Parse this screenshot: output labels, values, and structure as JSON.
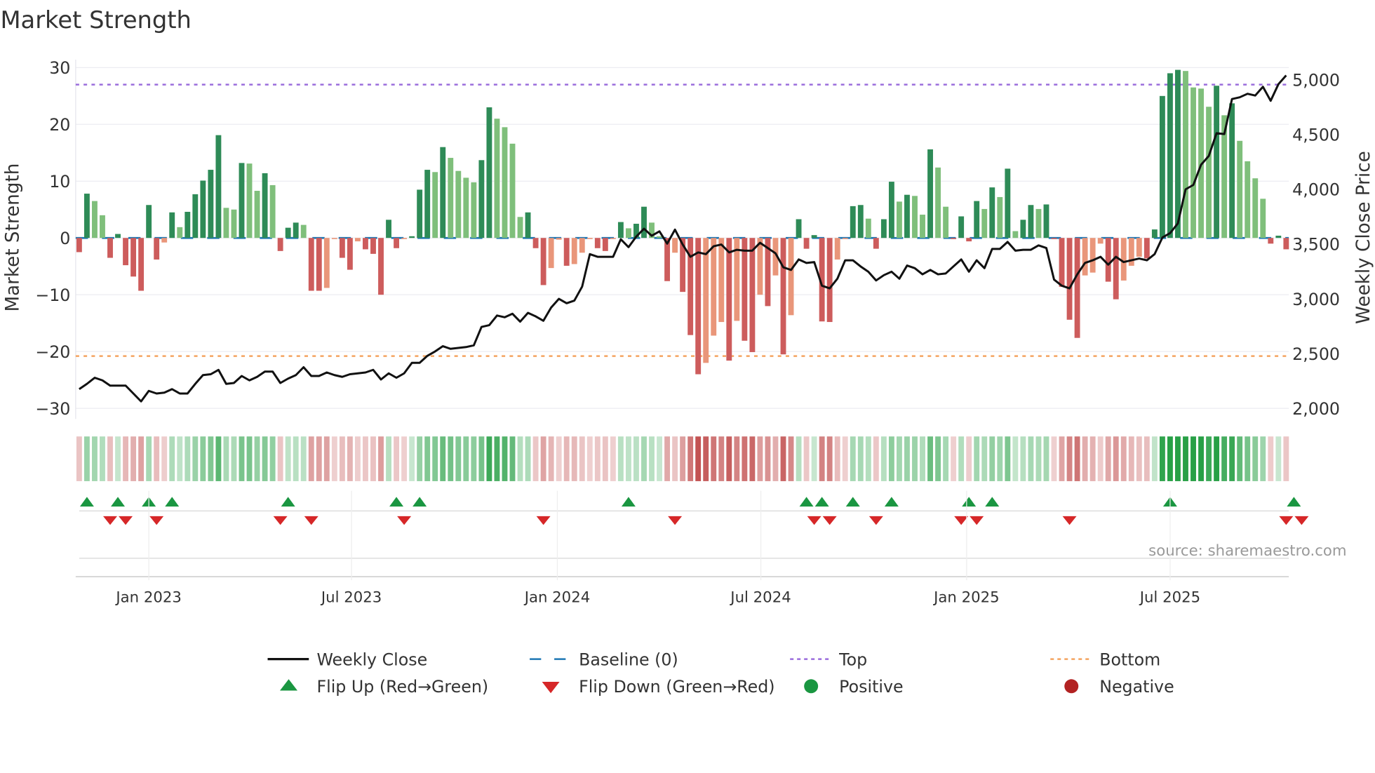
{
  "chart_data": {
    "type": "bar",
    "title": "Market Strength",
    "ylabel": "Market Strength",
    "y2label": "Weekly Close Price",
    "ylim": [
      -31.5,
      31.5
    ],
    "y2lim": [
      1900,
      5100
    ],
    "yticks": [
      30,
      20,
      10,
      0,
      -10,
      -20,
      -30
    ],
    "ytick_labels": [
      "30",
      "20",
      "10",
      "0",
      "−10",
      "−20",
      "−30"
    ],
    "y2ticks": [
      5000,
      4500,
      4000,
      3500,
      3000,
      2500,
      2000
    ],
    "y2tick_labels": [
      "5,000",
      "4,500",
      "4,000",
      "3,500",
      "3,000",
      "2,500",
      "2,000"
    ],
    "xticks": [
      {
        "index": 9,
        "label": "Jan 2023"
      },
      {
        "index": 35.2,
        "label": "Jul 2023"
      },
      {
        "index": 61.8,
        "label": "Jan 2024"
      },
      {
        "index": 88.1,
        "label": "Jul 2024"
      },
      {
        "index": 114.7,
        "label": "Jan 2025"
      },
      {
        "index": 141,
        "label": "Jul 2025"
      }
    ],
    "top_level": 27,
    "bottom_level": -20.8,
    "strength": [
      -2.5,
      7.8,
      6.5,
      4,
      -3.5,
      0.7,
      -4.8,
      -6.8,
      -9.3,
      5.8,
      -3.8,
      -0.8,
      4.5,
      1.9,
      4.6,
      7.7,
      10.1,
      12,
      18.1,
      5.3,
      5,
      13.2,
      13.1,
      8.3,
      11.4,
      9.3,
      -2.3,
      1.8,
      2.7,
      2.3,
      -9.3,
      -9.3,
      -8.8,
      -0.2,
      -3.5,
      -5.6,
      -0.6,
      -2,
      -2.8,
      -10,
      3.2,
      -1.8,
      -0.2,
      0.3,
      8.5,
      12,
      11.6,
      16,
      14.1,
      11.8,
      10.6,
      9.8,
      13.7,
      23,
      21,
      19.5,
      16.6,
      3.7,
      4.5,
      -1.8,
      -8.3,
      -5.3,
      -0.3,
      -4.9,
      -4.6,
      -2.6,
      -0.2,
      -1.8,
      -2.3,
      -0.2,
      2.8,
      1.7,
      2.5,
      5.5,
      2.7,
      0.3,
      -7.6,
      -2.6,
      -9.5,
      -17.1,
      -24,
      -22,
      -17.2,
      -14.8,
      -21.6,
      -14.6,
      -18.1,
      -20.1,
      -10,
      -12,
      -6.6,
      -20.5,
      -13.6,
      3.3,
      -1.9,
      0.5,
      -14.7,
      -14.8,
      -3.8,
      -0.2,
      5.6,
      5.8,
      3.4,
      -1.9,
      3.3,
      9.9,
      6.4,
      7.6,
      7.4,
      4.1,
      15.6,
      12.4,
      5.5,
      -0.2,
      3.8,
      -0.6,
      6.5,
      5.1,
      8.9,
      7.2,
      12.2,
      1.2,
      3.2,
      5.8,
      5.1,
      5.9,
      -0.2,
      -8.6,
      -14.4,
      -17.6,
      -6.6,
      -6.1,
      -1,
      -7.7,
      -10.8,
      -7.5,
      -4.9,
      -3.3,
      -3.6,
      1.5,
      25,
      29,
      29.6,
      29.4,
      26.5,
      26.3,
      23.1,
      26.8,
      21.6,
      23.7,
      17.1,
      13.5,
      10.5,
      6.9,
      -1,
      0.4,
      -2
    ],
    "weekly_close": [
      2176,
      2224,
      2280,
      2256,
      2208,
      2208,
      2208,
      2136,
      2064,
      2160,
      2136,
      2144,
      2176,
      2136,
      2136,
      2224,
      2304,
      2312,
      2352,
      2224,
      2232,
      2296,
      2256,
      2288,
      2336,
      2336,
      2232,
      2272,
      2304,
      2376,
      2296,
      2296,
      2328,
      2304,
      2288,
      2312,
      2320,
      2328,
      2352,
      2264,
      2320,
      2280,
      2320,
      2416,
      2416,
      2480,
      2520,
      2568,
      2544,
      2552,
      2560,
      2576,
      2744,
      2760,
      2848,
      2832,
      2864,
      2792,
      2872,
      2840,
      2800,
      2920,
      3000,
      2960,
      2984,
      3112,
      3408,
      3384,
      3384,
      3384,
      3544,
      3472,
      3568,
      3640,
      3576,
      3616,
      3504,
      3632,
      3496,
      3384,
      3424,
      3408,
      3480,
      3496,
      3424,
      3448,
      3440,
      3440,
      3512,
      3464,
      3416,
      3288,
      3264,
      3360,
      3328,
      3336,
      3120,
      3096,
      3184,
      3352,
      3352,
      3296,
      3248,
      3168,
      3216,
      3248,
      3184,
      3304,
      3280,
      3224,
      3264,
      3224,
      3232,
      3296,
      3360,
      3248,
      3352,
      3280,
      3456,
      3456,
      3520,
      3440,
      3448,
      3448,
      3488,
      3464,
      3176,
      3120,
      3096,
      3224,
      3328,
      3352,
      3384,
      3312,
      3384,
      3336,
      3352,
      3368,
      3352,
      3408,
      3560,
      3600,
      3688,
      4000,
      4040,
      4224,
      4304,
      4512,
      4504,
      4824,
      4840,
      4872,
      4856,
      4936,
      4808,
      4960,
      5040
    ],
    "flip_up_indices": [
      1,
      5,
      9,
      12,
      27,
      41,
      44,
      71,
      94,
      96,
      100,
      105,
      115,
      118,
      141,
      157
    ],
    "flip_down_indices": [
      4,
      6,
      10,
      26,
      30,
      42,
      60,
      77,
      95,
      97,
      103,
      114,
      116,
      128,
      156,
      158
    ],
    "legend": {
      "placement": "bottom",
      "items": [
        {
          "label": "Weekly Close",
          "symbol": "line"
        },
        {
          "label": "Baseline (0)",
          "symbol": "dash"
        },
        {
          "label": "Top",
          "symbol": "dot-purple"
        },
        {
          "label": "Bottom",
          "symbol": "dot-orange"
        },
        {
          "label": "Flip Up (Red→Green)",
          "symbol": "triangle-up"
        },
        {
          "label": "Flip Down (Green→Red)",
          "symbol": "triangle-down"
        },
        {
          "label": "Positive",
          "symbol": "circle-green"
        },
        {
          "label": "Negative",
          "symbol": "circle-red"
        }
      ]
    },
    "source": "source: sharemaestro.com",
    "colors": {
      "pos_up": "#2e8b57",
      "pos_down": "#7fbf7b",
      "neg_down": "#cd5c5c",
      "neg_up": "#e9967a",
      "baseline": "#1f77b4",
      "top": "#9b6ddc",
      "bottom": "#f4a460",
      "close": "#111111",
      "flip_up": "#1a9641",
      "flip_down": "#d62728",
      "positive": "#1a9641",
      "negative": "#b22222"
    }
  }
}
